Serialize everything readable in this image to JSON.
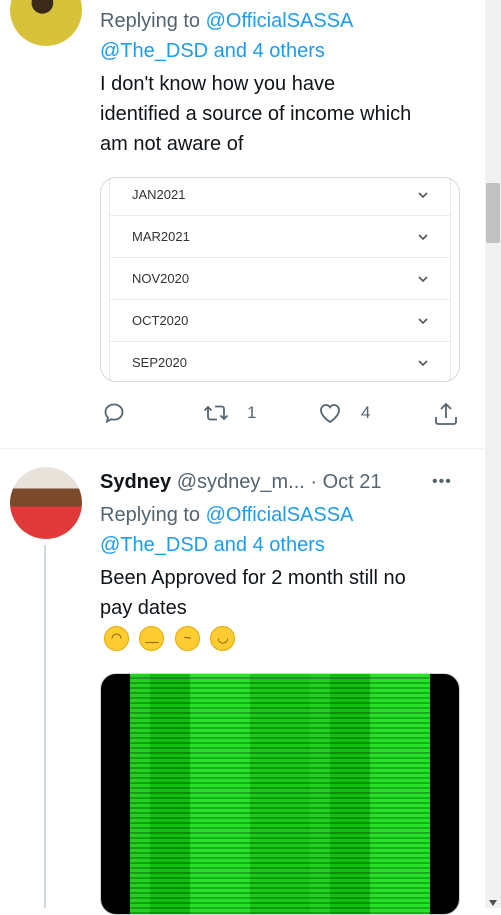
{
  "tweet1": {
    "replying_prefix": "Replying to",
    "replying_handle": "@OfficialSASSA",
    "replying_others": "@The_DSD and 4 others",
    "text_line1": "I don't know how you have",
    "text_line2": "identified a source of income which",
    "text_line3": "am not aware of",
    "months": [
      "JAN2021",
      "MAR2021",
      "NOV2020",
      "OCT2020",
      "SEP2020"
    ],
    "retweets": "1",
    "likes": "4"
  },
  "tweet2": {
    "name": "Sydney",
    "handle": "@sydney_m...",
    "date": "· Oct 21",
    "more": "•••",
    "replying_prefix": "Replying to",
    "replying_handle": "@OfficialSASSA",
    "replying_others": "@The_DSD and 4 others",
    "text_line1": "Been Approved for 2 month still no",
    "text_line2": "pay dates"
  },
  "icons": [
    "reply-icon",
    "retweet-icon",
    "like-icon",
    "share-icon",
    "chevron-down-icon"
  ],
  "colors": {
    "link": "#1d9bf0",
    "muted": "#536471",
    "media_green": "#1ad81a"
  }
}
